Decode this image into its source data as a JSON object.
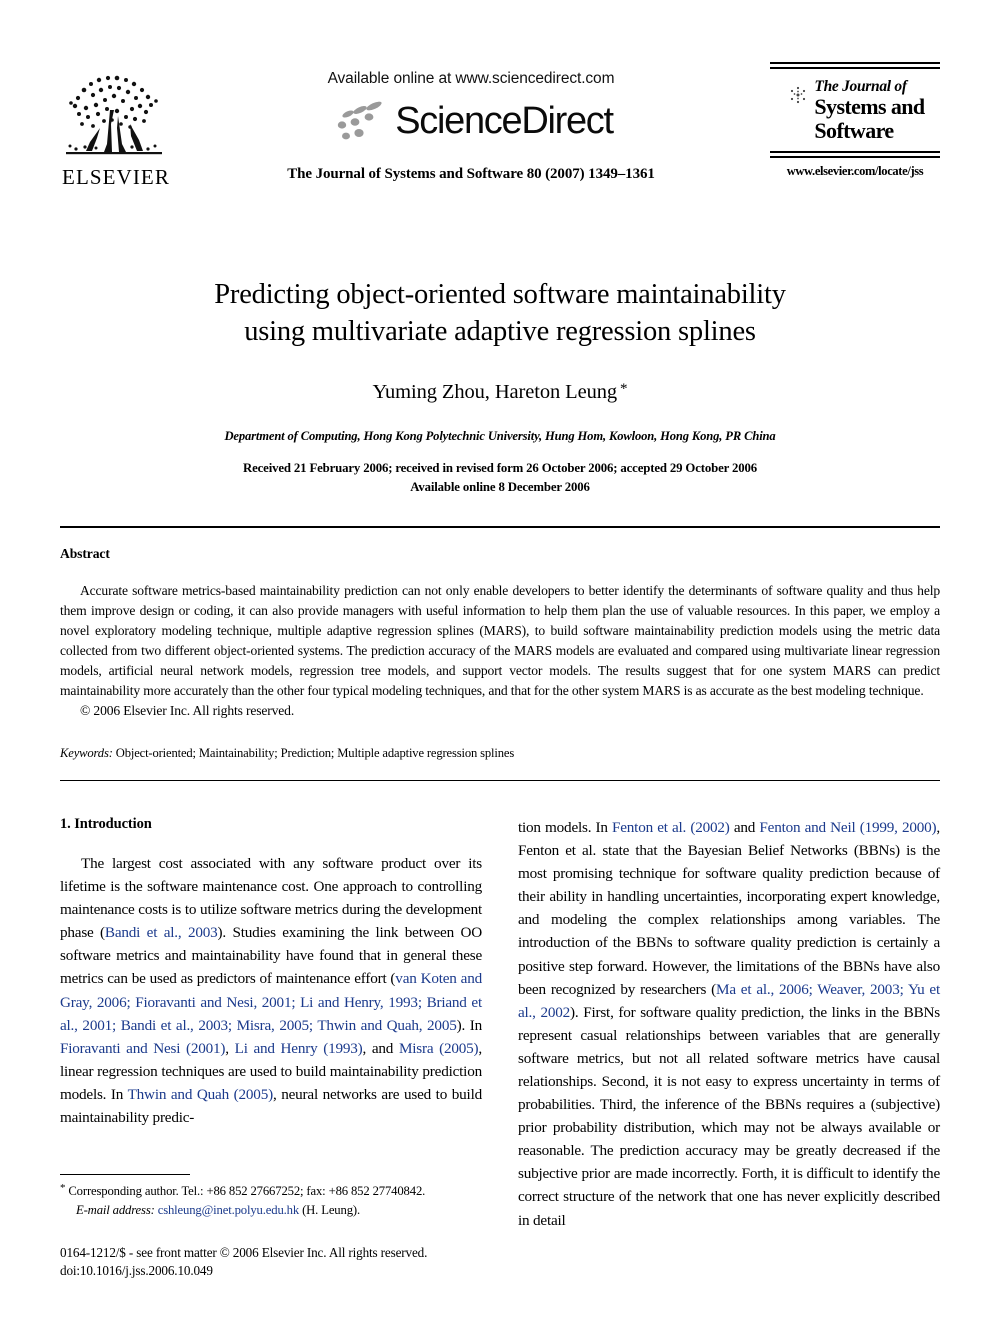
{
  "masthead": {
    "publisher_name": "ELSEVIER",
    "available_online": "Available online at www.sciencedirect.com",
    "sciencedirect_wordmark": "ScienceDirect",
    "journal_citation": "The Journal of Systems and Software 80 (2007) 1349–1361",
    "badge": {
      "line1": "The Journal of",
      "line2": "Systems and",
      "line3": "Software",
      "url": "www.elsevier.com/locate/jss"
    }
  },
  "article": {
    "title_line1": "Predicting object-oriented software maintainability",
    "title_line2": "using multivariate adaptive regression splines",
    "authors": "Yuming Zhou, Hareton Leung",
    "corresponding_marker": "*",
    "affiliation": "Department of Computing, Hong Kong Polytechnic University, Hung Hom, Kowloon, Hong Kong, PR China",
    "received_line": "Received 21 February 2006; received in revised form 26 October 2006; accepted 29 October 2006",
    "available_line": "Available online 8 December 2006"
  },
  "abstract": {
    "heading": "Abstract",
    "text": "Accurate software metrics-based maintainability prediction can not only enable developers to better identify the determinants of software quality and thus help them improve design or coding, it can also provide managers with useful information to help them plan the use of valuable resources. In this paper, we employ a novel exploratory modeling technique, multiple adaptive regression splines (MARS), to build software maintainability prediction models using the metric data collected from two different object-oriented systems. The prediction accuracy of the MARS models are evaluated and compared using multivariate linear regression models, artificial neural network models, regression tree models, and support vector models. The results suggest that for one system MARS can predict maintainability more accurately than the other four typical modeling techniques, and that for the other system MARS is as accurate as the best modeling technique.",
    "copyright": "© 2006 Elsevier Inc. All rights reserved.",
    "keywords_label": "Keywords:",
    "keywords_value": "Object-oriented; Maintainability; Prediction; Multiple adaptive regression splines"
  },
  "intro": {
    "heading": "1. Introduction",
    "left_paragraph_parts": [
      {
        "text": "The largest cost associated with any software product over its lifetime is the software maintenance cost. One approach to controlling maintenance costs is to utilize software metrics during the development phase (",
        "cite": false
      },
      {
        "text": "Bandi et al., 2003",
        "cite": true
      },
      {
        "text": "). Studies examining the link between OO software metrics and maintainability have found that in general these metrics can be used as predictors of maintenance effort (",
        "cite": false
      },
      {
        "text": "van Koten and Gray, 2006; Fioravanti and Nesi, 2001; Li and Henry, 1993; Briand et al., 2001; Bandi et al., 2003; Misra, 2005; Thwin and Quah, 2005",
        "cite": true
      },
      {
        "text": "). In ",
        "cite": false
      },
      {
        "text": "Fioravanti and Nesi (2001)",
        "cite": true
      },
      {
        "text": ", ",
        "cite": false
      },
      {
        "text": "Li and Henry (1993)",
        "cite": true
      },
      {
        "text": ", and ",
        "cite": false
      },
      {
        "text": "Misra (2005)",
        "cite": true
      },
      {
        "text": ", linear regression techniques are used to build maintainability prediction models. In ",
        "cite": false
      },
      {
        "text": "Thwin and Quah (2005)",
        "cite": true
      },
      {
        "text": ", neural networks are used to build maintainability predic-",
        "cite": false
      }
    ],
    "right_paragraph_parts": [
      {
        "text": "tion models. In ",
        "cite": false
      },
      {
        "text": "Fenton et al. (2002)",
        "cite": true
      },
      {
        "text": " and ",
        "cite": false
      },
      {
        "text": "Fenton and Neil (1999, 2000)",
        "cite": true
      },
      {
        "text": ", Fenton et al. state that the Bayesian Belief Networks (BBNs) is the most promising technique for software quality prediction because of their ability in handling uncertainties, incorporating expert knowledge, and modeling the complex relationships among variables. The introduction of the BBNs to software quality prediction is certainly a positive step forward. However, the limitations of the BBNs have also been recognized by researchers (",
        "cite": false
      },
      {
        "text": "Ma et al., 2006; Weaver, 2003; Yu et al., 2002",
        "cite": true
      },
      {
        "text": "). First, for software quality prediction, the links in the BBNs represent casual relationships between variables that are generally software metrics, but not all related software metrics have causal relationships. Second, it is not easy to express uncertainty in terms of probabilities. Third, the inference of the BBNs requires a (subjective) prior probability distribution, which may not be always available or reasonable. The prediction accuracy may be greatly decreased if the subjective prior are made incorrectly. Forth, it is difficult to identify the correct structure of the network that one has never explicitly described in detail",
        "cite": false
      }
    ]
  },
  "footnote": {
    "marker": "*",
    "corresponding_text": "Corresponding author. Tel.: +86 852 27667252; fax: +86 852 27740842.",
    "email_label": "E-mail address:",
    "email_address": "cshleung@inet.polyu.edu.hk",
    "email_suffix": "(H. Leung).",
    "issn_line": "0164-1212/$ - see front matter © 2006 Elsevier Inc. All rights reserved.",
    "doi_line": "doi:10.1016/j.jss.2006.10.049"
  },
  "colors": {
    "citation_link": "#1b3a8c",
    "text": "#000000",
    "page_background": "#ffffff",
    "sciencedirect_swoosh": "#9a9a9a"
  }
}
